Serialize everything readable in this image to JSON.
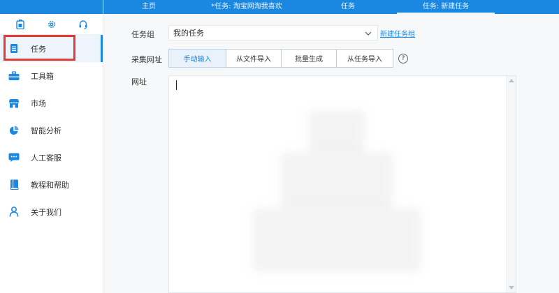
{
  "tabs": [
    {
      "label": "主页",
      "active": false
    },
    {
      "label": "*任务: 淘宝网淘我喜欢",
      "active": false
    },
    {
      "label": "任务",
      "active": false
    },
    {
      "label": "任务: 新建任务",
      "active": true
    }
  ],
  "sidebar": {
    "toolbar_icons": [
      "battery-icon",
      "gear-icon",
      "headset-icon"
    ],
    "items": [
      {
        "label": "任务",
        "icon": "task-list-icon",
        "active": true
      },
      {
        "label": "工具箱",
        "icon": "toolbox-icon",
        "active": false
      },
      {
        "label": "市场",
        "icon": "market-icon",
        "active": false
      },
      {
        "label": "智能分析",
        "icon": "pie-chart-icon",
        "active": false
      },
      {
        "label": "人工客服",
        "icon": "chat-icon",
        "active": false
      },
      {
        "label": "教程和帮助",
        "icon": "book-icon",
        "active": false
      },
      {
        "label": "关于我们",
        "icon": "person-icon",
        "active": false
      }
    ]
  },
  "form": {
    "group_label": "任务组",
    "group_value": "我的任务",
    "new_group_link": "新建任务组",
    "collect_label": "采集网址",
    "modes": [
      {
        "label": "手动输入",
        "active": true
      },
      {
        "label": "从文件导入",
        "active": false
      },
      {
        "label": "批量生成",
        "active": false
      },
      {
        "label": "从任务导入",
        "active": false
      }
    ],
    "help_symbol": "?",
    "url_label": "网址"
  },
  "colors": {
    "accent": "#1a88e0",
    "highlight": "#e53935"
  }
}
